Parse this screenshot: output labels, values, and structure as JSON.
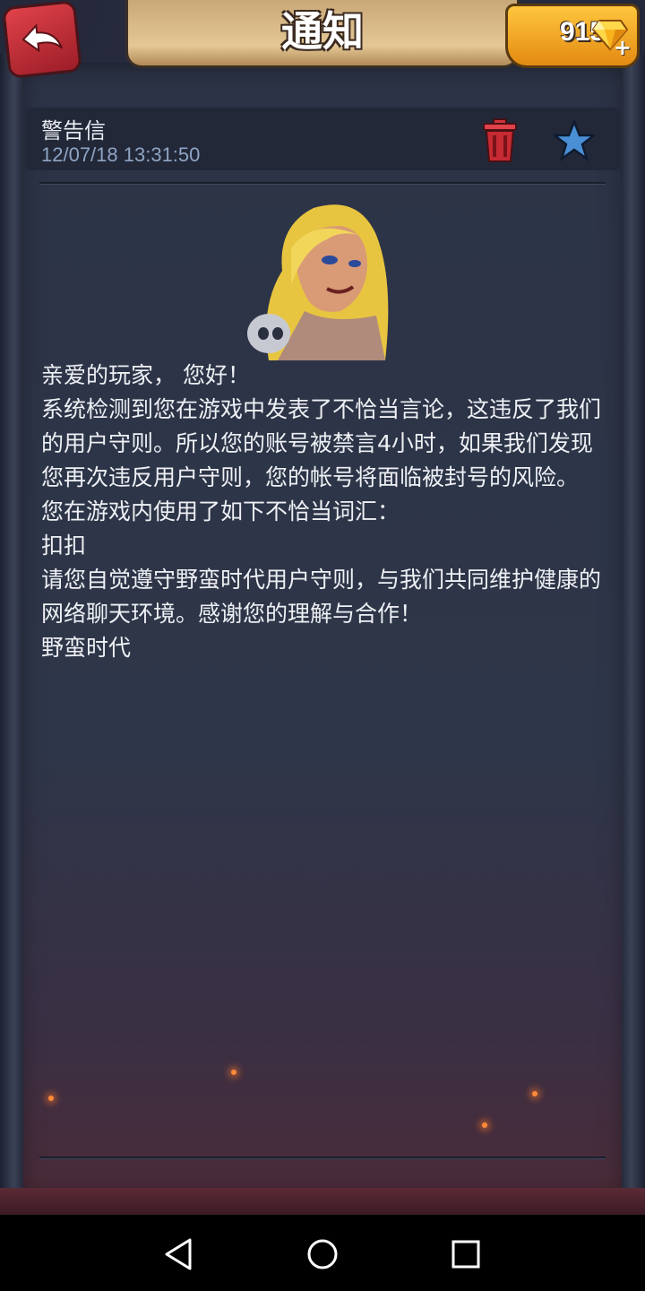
{
  "header": {
    "title": "通知",
    "gems": "915"
  },
  "mail": {
    "subject": "警告信",
    "timestamp": "12/07/18 13:31:50",
    "body": [
      "亲爱的玩家， 您好！",
      "系统检测到您在游戏中发表了不恰当言论，这违反了我们的用户守则。所以您的账号被禁言4小时，如果我们发现您再次违反用户守则，您的帐号将面临被封号的风险。 您在游戏内使用了如下不恰当词汇：",
      "扣扣",
      "请您自觉遵守野蛮时代用户守则，与我们共同维护健康的网络聊天环境。感谢您的理解与合作！",
      "野蛮时代"
    ]
  },
  "colors": {
    "back_button": "#c9303a",
    "gems_box": "#f5a623",
    "delete_icon": "#d0323a",
    "star_icon": "#4a8fd6",
    "subject_text": "#e9ecf2",
    "timestamp_text": "#8fa4c4"
  },
  "icons": {
    "back": "back-arrow-icon",
    "gem": "diamond-icon",
    "add": "plus-icon",
    "delete": "trash-icon",
    "favorite": "star-icon",
    "nav_back": "triangle-back-icon",
    "nav_home": "circle-home-icon",
    "nav_recent": "square-recent-icon"
  }
}
